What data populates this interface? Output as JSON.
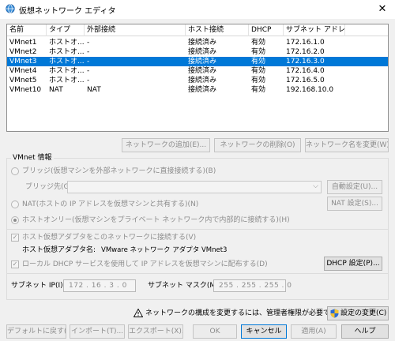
{
  "window": {
    "title": "仮想ネットワーク エディタ",
    "close": "✕"
  },
  "list": {
    "columns": [
      "名前",
      "タイプ",
      "外部接続",
      "ホスト接続",
      "DHCP",
      "サブネット アドレス"
    ],
    "rows": [
      [
        "VMnet1",
        "ホストオ...",
        "-",
        "接続済み",
        "有効",
        "172.16.1.0"
      ],
      [
        "VMnet2",
        "ホストオ...",
        "-",
        "接続済み",
        "有効",
        "172.16.2.0"
      ],
      [
        "VMnet3",
        "ホストオ...",
        "-",
        "接続済み",
        "有効",
        "172.16.3.0"
      ],
      [
        "VMnet4",
        "ホストオ...",
        "-",
        "接続済み",
        "有効",
        "172.16.4.0"
      ],
      [
        "VMnet5",
        "ホストオ...",
        "-",
        "接続済み",
        "有効",
        "172.16.5.0"
      ],
      [
        "VMnet10",
        "NAT",
        "NAT",
        "接続済み",
        "有効",
        "192.168.10.0"
      ]
    ],
    "selected_row": 2
  },
  "list_buttons": {
    "add": "ネットワークの追加(E)...",
    "remove": "ネットワークの削除(O)",
    "rename": "ネットワーク名を変更(W)..."
  },
  "vmnet_info": {
    "group_label": "VMnet 情報",
    "bridged_label": "ブリッジ(仮想マシンを外部ネットワークに直接接続する)(B)",
    "bridge_to_label": "ブリッジ先(G):",
    "bridge_to_value": "",
    "auto_settings": "自動設定(U)...",
    "nat_label": "NAT(ホストの IP アドレスを仮想マシンと共有する)(N)",
    "nat_settings": "NAT 設定(S)...",
    "hostonly_label": "ホストオンリー(仮想マシンをプライベート ネットワーク内で内部的に接続する)(H)",
    "connect_adapter_label": "ホスト仮想アダプタをこのネットワークに接続する(V)",
    "adapter_name_label": "ホスト仮想アダプタ名:",
    "adapter_name_value": "VMware ネットワーク アダプタ VMnet3",
    "dhcp_label": "ローカル DHCP サービスを使用して IP アドレスを仮想マシンに配布する(D)",
    "dhcp_settings": "DHCP 設定(P)...",
    "subnet_ip_label": "サブネット IP(I):",
    "subnet_ip_value": "172 . 16 . 3 . 0",
    "subnet_mask_label": "サブネット マスク(M):",
    "subnet_mask_value": "255 . 255 . 255 . 0"
  },
  "admin_notice": {
    "icon": "warning-icon",
    "text": "ネットワークの構成を変更するには、管理者権限が必要です。",
    "change_settings": "設定の変更(C)"
  },
  "footer": {
    "restore_defaults": "デフォルトに戻す(R)",
    "import": "インポート(T)...",
    "export": "エクスポート(X)...",
    "ok": "OK",
    "cancel": "キャンセル",
    "apply": "適用(A)",
    "help": "ヘルプ"
  },
  "colors": {
    "selection": "#0078d7",
    "window_bg": "#f0f0f0",
    "disabled_text": "#8c8c8c"
  }
}
